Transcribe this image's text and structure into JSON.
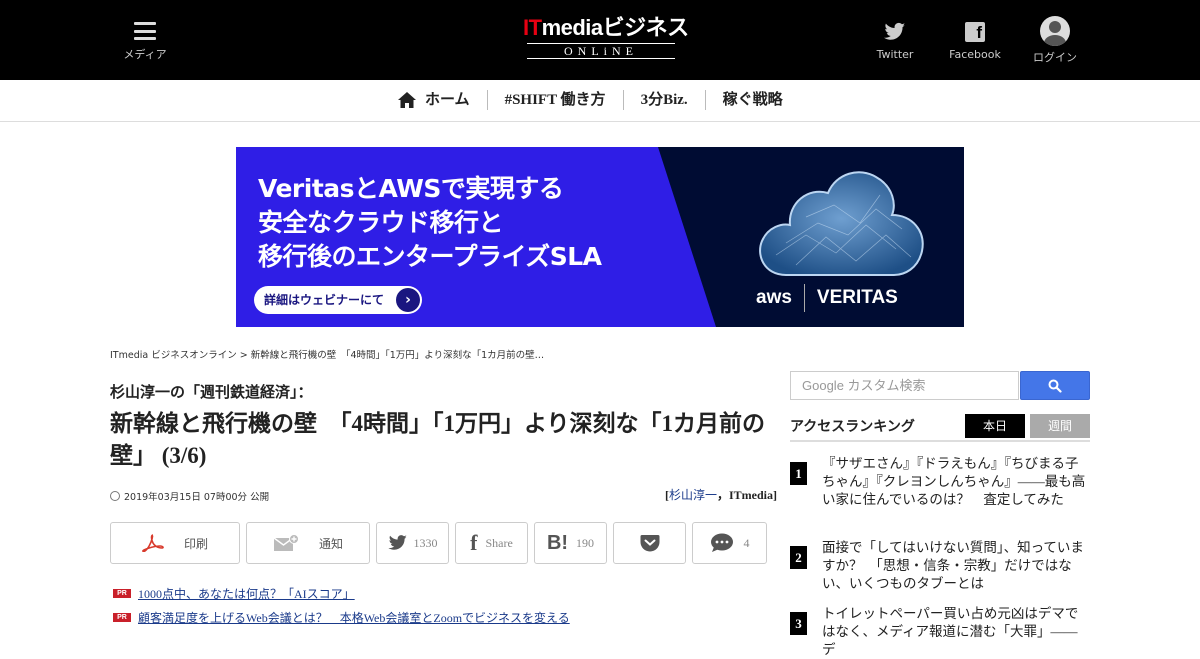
{
  "header": {
    "menu_label": "メディア",
    "logo_main": "ITmediaビジネス",
    "logo_it": "IT",
    "logo_rest": "mediaビジネス",
    "logo_sub": "ONLiNE",
    "twitter_label": "Twitter",
    "facebook_label": "Facebook",
    "login_label": "ログイン"
  },
  "nav": {
    "items": [
      {
        "label": "ホーム"
      },
      {
        "label": "#SHIFT 働き方"
      },
      {
        "label": "3分Biz."
      },
      {
        "label": "稼ぐ戦略"
      }
    ]
  },
  "ad": {
    "line1": "VeritasとAWSで実現する",
    "line2": "安全なクラウド移行と",
    "line3": "移行後のエンタープライズSLA",
    "cta": "詳細はウェビナーにて",
    "brand_aws": "aws",
    "brand_veritas": "VERITAS",
    "colors": {
      "bg": "#2f1ee6",
      "dark": "#000c33"
    }
  },
  "article": {
    "breadcrumb": "ITmedia ビジネスオンライン > 新幹線と飛行機の壁　「4時間」「1万円」より深刻な「1カ月前の壁…",
    "series": "杉山淳一の「週刊鉄道経済」：",
    "title": "新幹線と飛行機の壁　「4時間」「1万円」より深刻な「1カ月前の壁」 (3/6)",
    "date": "2019年03月15日 07時00分 公開",
    "author_open": "[",
    "author_link": "杉山淳一",
    "author_rest": "，ITmedia]",
    "share": {
      "print": "印刷",
      "notify": "通知",
      "twitter_count": "1330",
      "facebook": "Share",
      "hatena_count": "190",
      "comment_count": "4"
    },
    "pr_badge": "PR",
    "pr_links": [
      "1000点中、あなたは何点？「AIスコア」",
      "顧客満足度を上げるWeb会議とは？　本格Web会議室とZoomでビジネスを変える"
    ]
  },
  "sidebar": {
    "search_placeholder": "Google カスタム検索",
    "ranking_title": "アクセスランキング",
    "tab_today": "本日",
    "tab_week": "週間",
    "ranking": [
      {
        "rank": "1",
        "text": "『サザエさん』『ドラえもん』『ちびまる子ちゃん』『クレヨンしんちゃん』――最も高い家に住んでいるのは？　査定してみた"
      },
      {
        "rank": "2",
        "text": "面接で「してはいけない質問」、知っていますか？　「思想・信条・宗教」だけではない、いくつものタブーとは"
      },
      {
        "rank": "3",
        "text": "トイレットペーパー買い占め元凶はデマではなく、メディア報道に潜む「大罪」――デ"
      }
    ]
  }
}
